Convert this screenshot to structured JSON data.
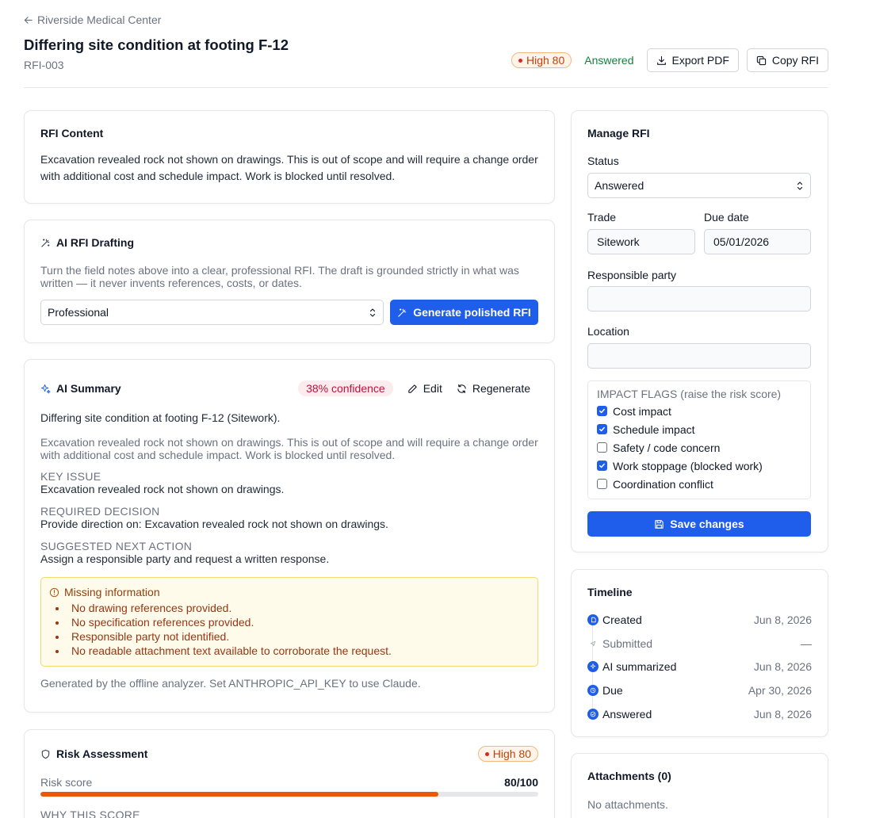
{
  "header": {
    "back_label": "Riverside Medical Center",
    "title": "Differing site condition at footing F-12",
    "rfi_id": "RFI-003",
    "risk_badge": "High 80",
    "status": "Answered",
    "export_label": "Export PDF",
    "copy_label": "Copy RFI"
  },
  "content_card": {
    "title": "RFI Content",
    "text": "Excavation revealed rock not shown on drawings. This is out of scope and will require a change order with additional cost and schedule impact. Work is blocked until resolved."
  },
  "drafting_card": {
    "title": "AI RFI Drafting",
    "description": "Turn the field notes above into a clear, professional RFI. The draft is grounded strictly in what was written — it never invents references, costs, or dates.",
    "tone_selected": "Professional",
    "generate_label": "Generate polished RFI"
  },
  "summary_card": {
    "title": "AI Summary",
    "confidence": "38% confidence",
    "edit_label": "Edit",
    "regenerate_label": "Regenerate",
    "headline": "Differing site condition at footing F-12 (Sitework).",
    "description": "Excavation revealed rock not shown on drawings. This is out of scope and will require a change order with additional cost and schedule impact. Work is blocked until resolved.",
    "key_issue_label": "KEY ISSUE",
    "key_issue": "Excavation revealed rock not shown on drawings.",
    "required_decision_label": "REQUIRED DECISION",
    "required_decision": "Provide direction on: Excavation revealed rock not shown on drawings.",
    "next_action_label": "SUGGESTED NEXT ACTION",
    "next_action": "Assign a responsible party and request a written response.",
    "missing_title": "Missing information",
    "missing_items": [
      "No drawing references provided.",
      "No specification references provided.",
      "Responsible party not identified.",
      "No readable attachment text available to corroborate the request."
    ],
    "footer": "Generated by the offline analyzer. Set ANTHROPIC_API_KEY to use Claude."
  },
  "risk_card": {
    "title": "Risk Assessment",
    "badge": "High 80",
    "score_label": "Risk score",
    "score_text": "80/100",
    "score_fraction": 0.8,
    "why_label": "WHY THIS SCORE"
  },
  "manage": {
    "title": "Manage RFI",
    "status_label": "Status",
    "status_value": "Answered",
    "trade_label": "Trade",
    "trade_value": "Sitework",
    "due_label": "Due date",
    "due_value": "05/01/2026",
    "responsible_label": "Responsible party",
    "responsible_value": "",
    "location_label": "Location",
    "location_value": "",
    "flags_title": "IMPACT FLAGS (raise the risk score)",
    "flags": [
      {
        "label": "Cost impact",
        "checked": true
      },
      {
        "label": "Schedule impact",
        "checked": true
      },
      {
        "label": "Safety / code concern",
        "checked": false
      },
      {
        "label": "Work stoppage (blocked work)",
        "checked": true
      },
      {
        "label": "Coordination conflict",
        "checked": false
      }
    ],
    "save_label": "Save changes"
  },
  "timeline": {
    "title": "Timeline",
    "events": [
      {
        "label": "Created",
        "date": "Jun 8, 2026",
        "done": true,
        "icon": "document-icon"
      },
      {
        "label": "Submitted",
        "date": "—",
        "done": false,
        "icon": "send-icon"
      },
      {
        "label": "AI summarized",
        "date": "Jun 8, 2026",
        "done": true,
        "icon": "sparkle-icon"
      },
      {
        "label": "Due",
        "date": "Apr 30, 2026",
        "done": true,
        "icon": "clock-icon"
      },
      {
        "label": "Answered",
        "date": "Jun 8, 2026",
        "done": true,
        "icon": "check-circle-icon"
      }
    ]
  },
  "attachments": {
    "title": "Attachments (0)",
    "empty": "No attachments."
  }
}
